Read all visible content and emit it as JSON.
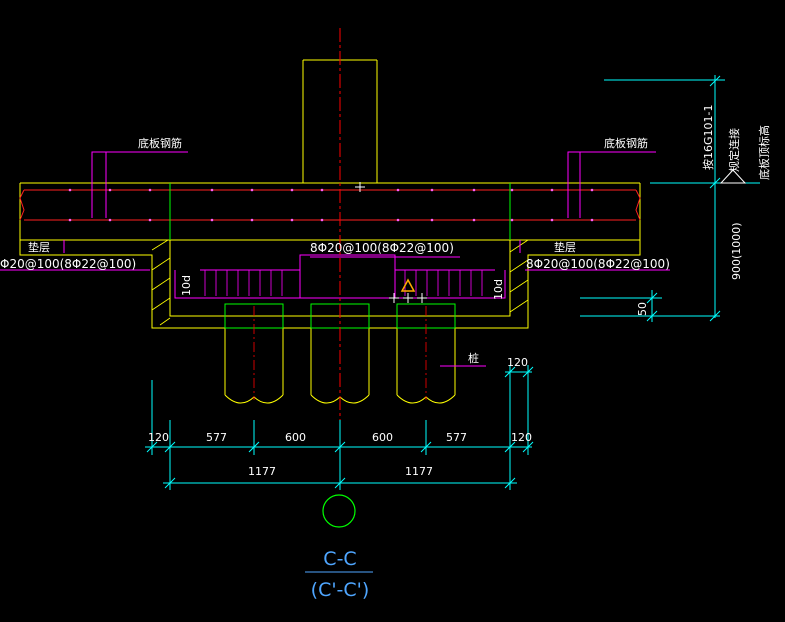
{
  "drawing": {
    "section_title": "C-C",
    "section_subtitle": "(C'-C')",
    "rebar_bottom_plate_left": "底板钢筋",
    "rebar_bottom_plate_right": "底板钢筋",
    "cushion_left": "垫层",
    "cushion_right": "垫层",
    "rebar_left": "Φ20@100(8Φ22@100)",
    "rebar_right": "8Φ20@100(8Φ22@100)",
    "rebar_middle": "8Φ20@100(8Φ22@100)",
    "anchor_left": "10d",
    "anchor_right": "10d",
    "pile_label": "桩",
    "ref_standard": "按16G101-1",
    "ref_connection": "规定连接",
    "bottom_elevation": "底板顶标高",
    "height_label": "900(1000)",
    "dim_50": "50",
    "dim_120_side": "120",
    "dims_row1": [
      "120",
      "577",
      "600",
      "600",
      "577",
      "120"
    ],
    "dims_row2": [
      "1177",
      "1177"
    ]
  },
  "colors": {
    "background": "#000000",
    "concrete": "#ffff00",
    "rebar": "#ff00ff",
    "rebar_main": "#ff2020",
    "dimension": "#00ffff",
    "pile_cap": "#00ff00",
    "centerline": "#ff0000",
    "text": "#ffffff",
    "title": "#4fa6ff",
    "warning": "#ffaa00"
  }
}
